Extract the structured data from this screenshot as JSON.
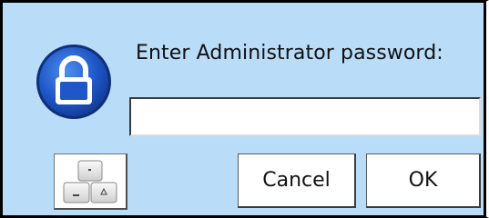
{
  "dialog": {
    "prompt": "Enter Administrator password:",
    "password_value": "",
    "lock_icon": "padlock-icon",
    "keyboard_icon": "keyboard-icon"
  },
  "buttons": {
    "cancel_label": "Cancel",
    "ok_label": "OK"
  },
  "colors": {
    "dialog_background": "#b9dcf9",
    "icon_blue": "#1b4fb8",
    "border": "#000000"
  }
}
